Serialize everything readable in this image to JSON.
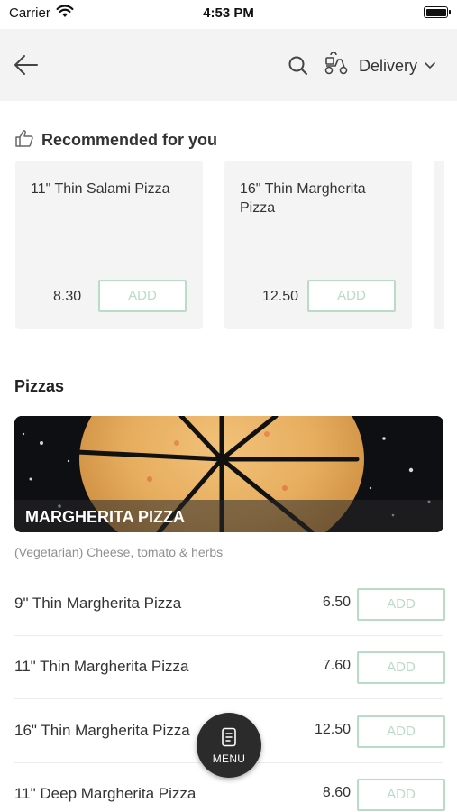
{
  "status_bar": {
    "carrier": "Carrier",
    "time": "4:53 PM",
    "icons": [
      "wifi-icon",
      "battery-icon"
    ]
  },
  "nav": {
    "back_icon": "arrow-left-icon",
    "search_icon": "search-icon",
    "delivery_icon": "scooter-icon",
    "delivery_label": "Delivery",
    "dropdown_icon": "chevron-down-icon"
  },
  "recommended": {
    "title": "Recommended for you",
    "icon": "thumbs-up-icon",
    "items": [
      {
        "name": "11\" Thin Salami Pizza",
        "price": "8.30",
        "add_label": "ADD"
      },
      {
        "name": "16\" Thin Margherita Pizza",
        "price": "12.50",
        "add_label": "ADD"
      }
    ]
  },
  "pizzas": {
    "section_title": "Pizzas",
    "banner_title": "MARGHERITA PIZZA",
    "description": "(Vegetarian) Cheese, tomato & herbs",
    "items": [
      {
        "name": "9\" Thin Margherita Pizza",
        "price": "6.50",
        "add_label": "ADD"
      },
      {
        "name": "11\" Thin Margherita Pizza",
        "price": "7.60",
        "add_label": "ADD"
      },
      {
        "name": "16\" Thin Margherita Pizza",
        "price": "12.50",
        "add_label": "ADD"
      },
      {
        "name": "11\" Deep Margherita Pizza",
        "price": "8.60",
        "add_label": "ADD"
      }
    ]
  },
  "menu_button": {
    "label": "MENU",
    "icon": "menu-card-icon"
  },
  "colors": {
    "accent": "#b9dcc6",
    "nav_background": "#f3f3f3",
    "card_background": "#f4f4f4",
    "fab_background": "#2b2b2b"
  }
}
